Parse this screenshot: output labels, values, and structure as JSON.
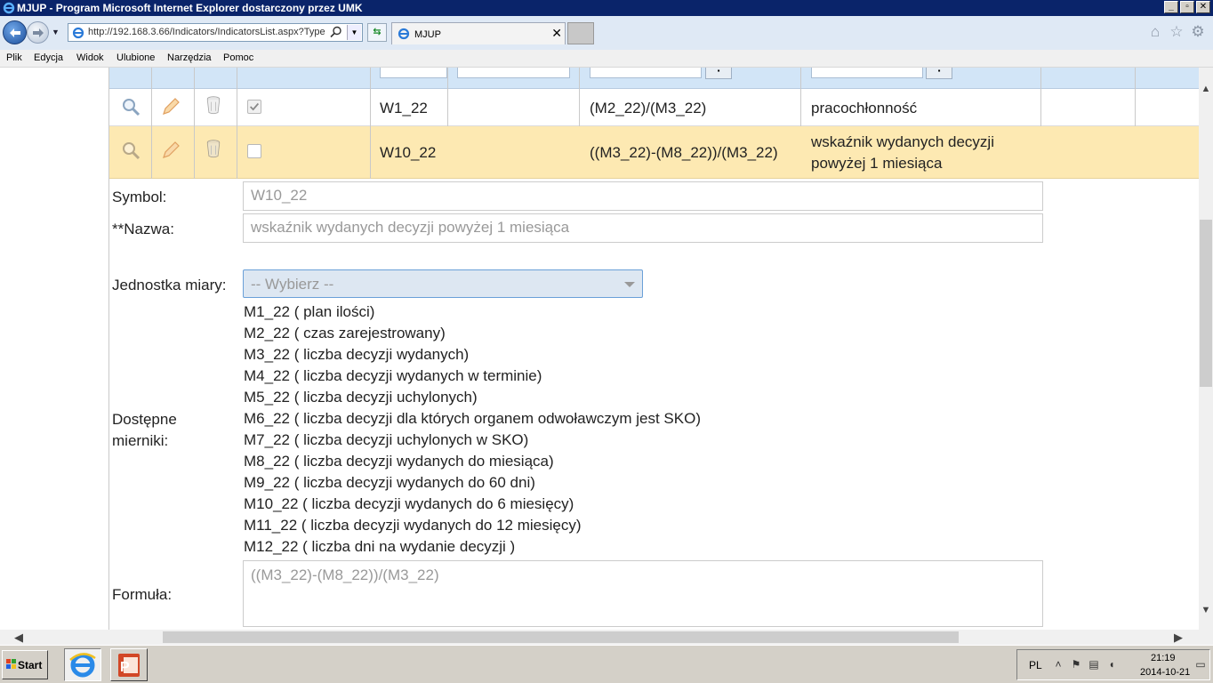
{
  "window": {
    "title": "MJUP - Program Microsoft Internet Explorer dostarczony przez UMK",
    "buttons": {
      "minimize": "_",
      "maximize": "▫",
      "close": "✕"
    }
  },
  "nav": {
    "url": "http://192.168.3.66/Indicators/IndicatorsList.aspx?Type",
    "tab_label": "MJUP",
    "tab_close": "✕"
  },
  "menu": {
    "items": [
      "Plik",
      "Edycja",
      "Widok",
      "Ulubione",
      "Narzędzia",
      "Pomoc"
    ]
  },
  "grid": {
    "rows": [
      {
        "symbol": "W1_22",
        "formula": "(M2_22)/(M3_22)",
        "name_line1": "pracochłonność",
        "name_line2": "",
        "checked": true
      },
      {
        "symbol": "W10_22",
        "formula": "((M3_22)-(M8_22))/(M3_22)",
        "name_line1": "wskaźnik wydanych decyzji",
        "name_line2": "powyżej 1 miesiąca",
        "checked": false
      }
    ]
  },
  "form": {
    "symbol_label": "Symbol:",
    "symbol_value": "W10_22",
    "name_label": "**Nazwa:",
    "name_value": "wskaźnik wydanych decyzji powyżej 1 miesiąca",
    "unit_label": "Jednostka miary:",
    "unit_value": "-- Wybierz --",
    "meters_label_line1": "Dostępne",
    "meters_label_line2": "mierniki:",
    "meters": [
      "M1_22 ( plan ilości)",
      "M2_22 ( czas zarejestrowany)",
      "M3_22 ( liczba decyzji wydanych)",
      "M4_22 ( liczba decyzji wydanych w terminie)",
      "M5_22 ( liczba decyzji uchylonych)",
      "M6_22 ( liczba decyzji dla których organem odwoławczym jest SKO)",
      "M7_22 ( liczba decyzji uchylonych w SKO)",
      "M8_22 ( liczba decyzji wydanych do miesiąca)",
      "M9_22 ( liczba decyzji wydanych do 60 dni)",
      "M10_22 ( liczba decyzji wydanych do 6 miesięcy)",
      "M11_22 ( liczba decyzji wydanych do 12 miesięcy)",
      "M12_22 ( liczba dni na wydanie decyzji )"
    ],
    "formula_label": "Formuła:",
    "formula_value": "((M3_22)-(M8_22))/(M3_22)"
  },
  "taskbar": {
    "start_label": "Start",
    "lang": "PL",
    "time": "21:19",
    "date": "2014-10-21"
  },
  "colors": {
    "highlight_row": "#fde9b2",
    "filter_row": "#d2e5f7",
    "title_bar": "#0a246a"
  }
}
